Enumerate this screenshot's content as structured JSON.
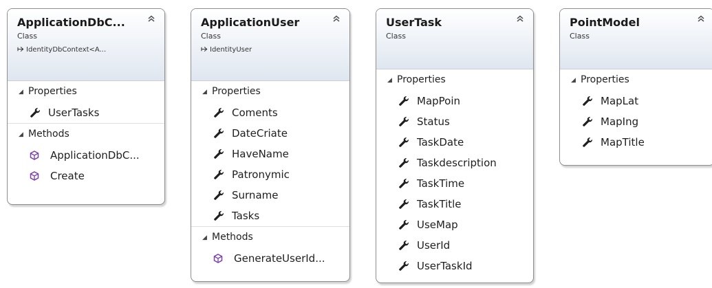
{
  "diagram": {
    "classes": [
      {
        "name": "ApplicationDbC...",
        "stereotype": "Class",
        "inherits": "IdentityDbContext<A...",
        "sections": [
          {
            "label": "Properties",
            "kind": "property",
            "members": [
              "UserTasks"
            ]
          },
          {
            "label": "Methods",
            "kind": "method",
            "members": [
              "ApplicationDbC...",
              "Create"
            ]
          }
        ]
      },
      {
        "name": "ApplicationUser",
        "stereotype": "Class",
        "inherits": "IdentityUser",
        "sections": [
          {
            "label": "Properties",
            "kind": "property",
            "members": [
              "Coments",
              "DateCriate",
              "HaveName",
              "Patronymic",
              "Surname",
              "Tasks"
            ]
          },
          {
            "label": "Methods",
            "kind": "method",
            "members": [
              "GenerateUserId..."
            ]
          }
        ]
      },
      {
        "name": "UserTask",
        "stereotype": "Class",
        "inherits": "",
        "sections": [
          {
            "label": "Properties",
            "kind": "property",
            "members": [
              "MapPoin",
              "Status",
              "TaskDate",
              "Taskdescription",
              "TaskTime",
              "TaskTitle",
              "UseMap",
              "UserId",
              "UserTaskId"
            ]
          }
        ]
      },
      {
        "name": "PointModel",
        "stereotype": "Class",
        "inherits": "",
        "sections": [
          {
            "label": "Properties",
            "kind": "property",
            "members": [
              "MapLat",
              "MapIng",
              "MapTitle"
            ]
          }
        ]
      }
    ]
  },
  "icons": {
    "collapse": "double-chevron-up-icon",
    "inherit": "inherit-arrow-icon",
    "section_expanded": "triangle-expanded-icon",
    "property": "wrench-icon",
    "method": "method-cube-icon"
  },
  "colors": {
    "method_icon": "#7a3fb0",
    "property_icon": "#1f1f1f",
    "border": "#8e8e8e",
    "header_gradient": "#dfe6ef"
  }
}
